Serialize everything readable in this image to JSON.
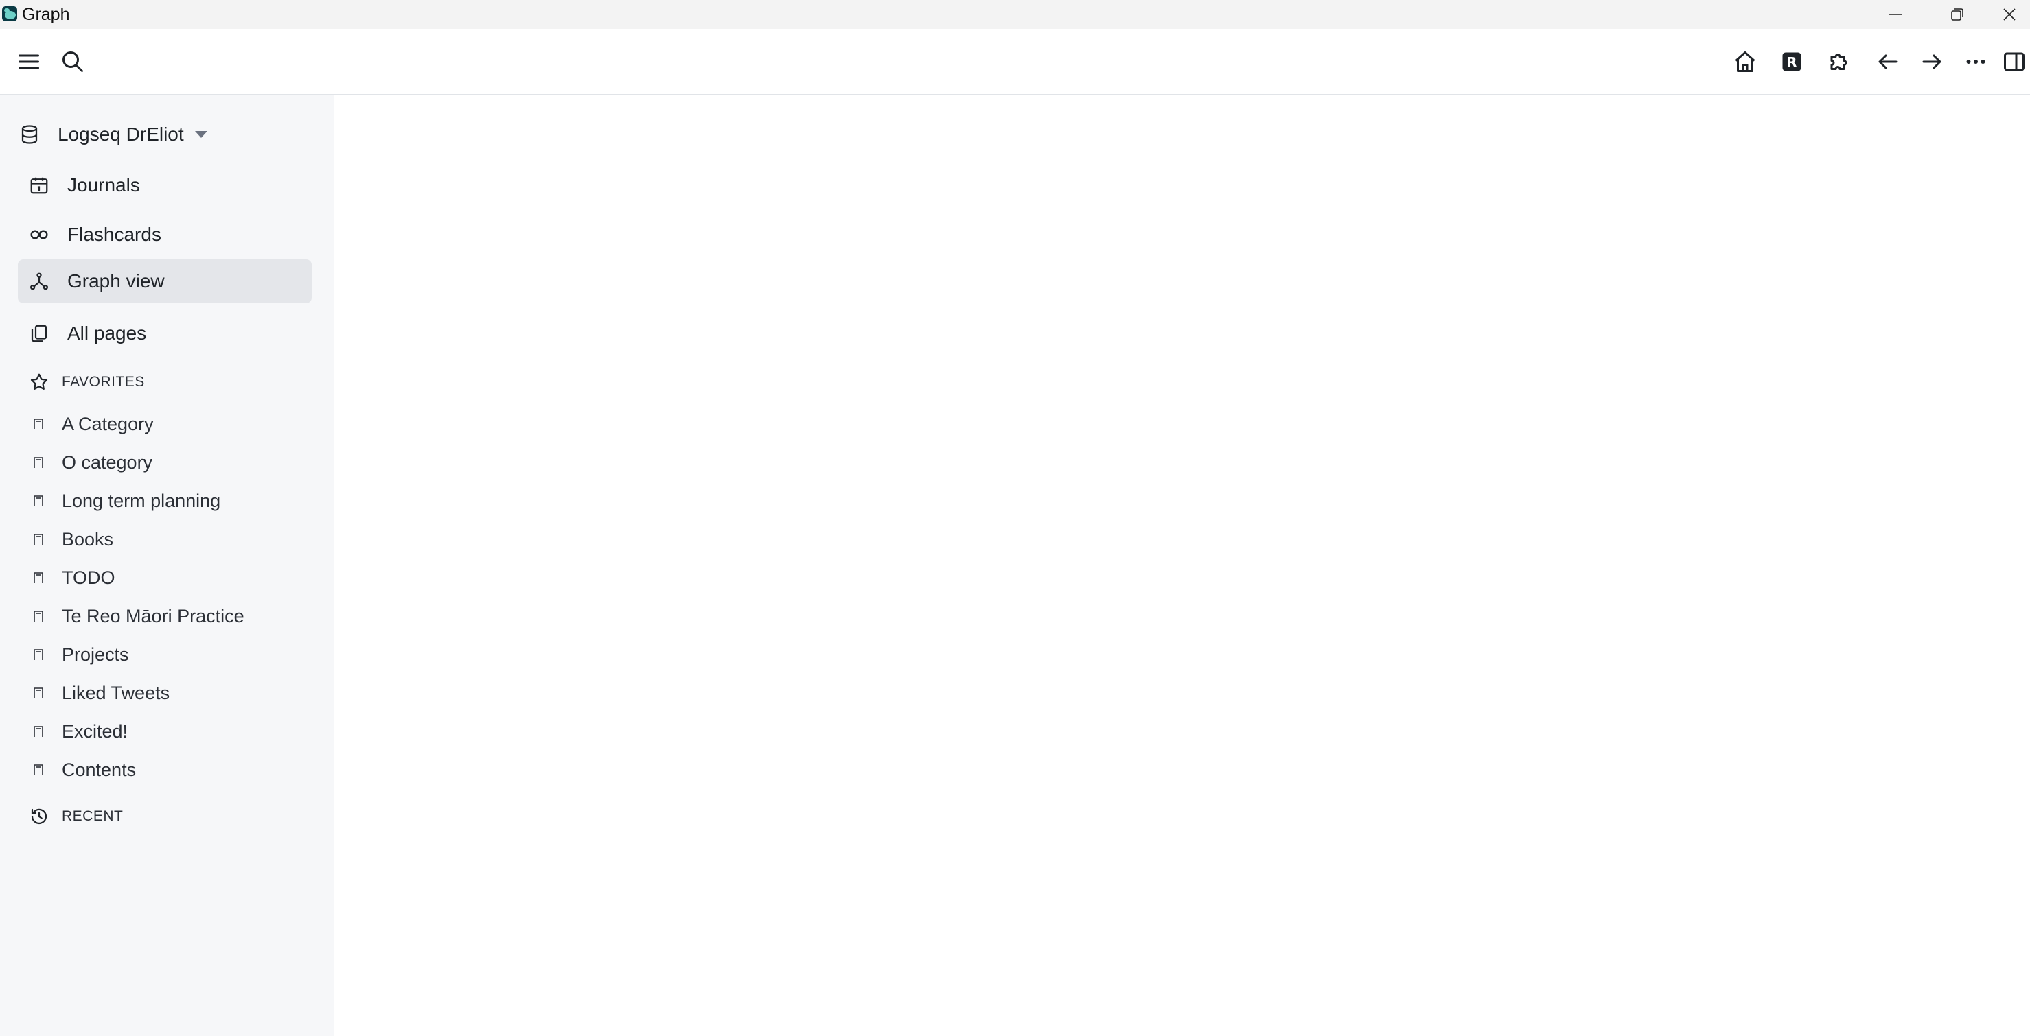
{
  "window": {
    "title": "Graph"
  },
  "header": {
    "buttons": [
      "menu-icon",
      "search-icon",
      "home-icon",
      "r-logo-icon",
      "puzzle-icon",
      "arrow-left-icon",
      "arrow-right-icon",
      "more-icon",
      "sidebar-toggle-icon"
    ]
  },
  "sidebar": {
    "graph_name": "Logseq DrEliot",
    "nav": [
      {
        "label": "Journals",
        "icon": "calendar-icon"
      },
      {
        "label": "Flashcards",
        "icon": "infinity-icon"
      },
      {
        "label": "Graph view",
        "icon": "graph-icon",
        "active": true
      },
      {
        "label": "All pages",
        "icon": "pages-icon"
      }
    ],
    "favorites_title": "FAVORITES",
    "favorites": [
      "A Category",
      "O category",
      "Long term planning",
      "Books",
      "TODO",
      "Te Reo Māori Practice",
      "Projects",
      "Liked Tweets",
      "Excited!",
      "Contents"
    ],
    "recent_title": "RECENT"
  }
}
